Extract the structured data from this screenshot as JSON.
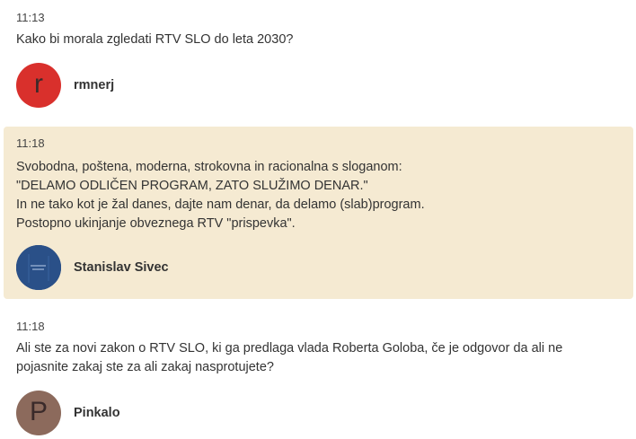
{
  "comments": [
    {
      "time": "11:13",
      "lines": [
        "Kako bi morala zgledati RTV SLO do leta 2030?"
      ],
      "author": "rmnerj",
      "avatar_letter": "r",
      "avatar_color": "#d9302c"
    },
    {
      "time": "11:18",
      "lines": [
        "Svobodna, poštena, moderna, strokovna in racionalna s sloganom:",
        "\"DELAMO ODLIČEN PROGRAM, ZATO SLUŽIMO DENAR.\"",
        "In ne tako kot je žal danes, dajte nam denar, da delamo (slab)program.",
        "Postopno ukinjanje obveznega RTV \"prispevka\"."
      ],
      "author": "Stanislav Sivec",
      "avatar_icon": "profile-photo",
      "avatar_color": "#24467a",
      "highlight_color": "#f5ead2"
    },
    {
      "time": "11:18",
      "lines": [
        "Ali ste za novi zakon o RTV SLO, ki ga predlaga vlada Roberta Goloba, če je odgovor da ali ne",
        "pojasnite zakaj ste za ali zakaj nasprotujete?"
      ],
      "author": "Pinkalo",
      "avatar_letter": "P",
      "avatar_color": "#8c6a5c"
    }
  ]
}
